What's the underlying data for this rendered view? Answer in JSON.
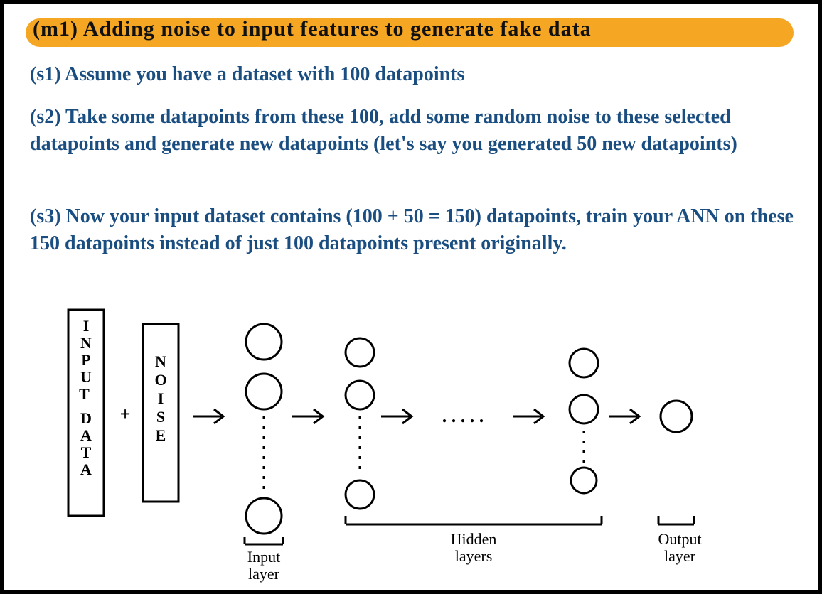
{
  "title": "(m1) Adding noise to input features to generate fake data",
  "steps": {
    "s1": "(s1) Assume you have a dataset with 100 datapoints",
    "s2": "(s2) Take some datapoints from these 100, add some random noise to these selected datapoints and generate new datapoints (let's say you generated 50 new datapoints)",
    "s3": "(s3) Now your input dataset contains (100 + 50 = 150) datapoints, train your ANN on these 150 datapoints instead of just 100 datapoints present originally."
  },
  "diagram": {
    "box1": "INPUT DATA",
    "plus": "+",
    "box2": "NOISE",
    "ellipsis": ". . . . .",
    "labels": {
      "input_layer": "Input layer",
      "hidden_layers": "Hidden layers",
      "output_layer": "Output layer"
    }
  }
}
